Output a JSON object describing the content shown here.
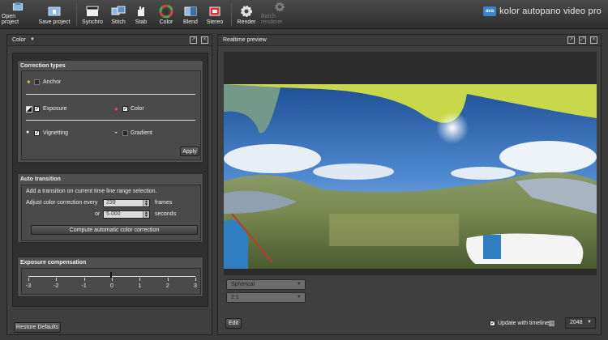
{
  "toolbar": {
    "items": [
      {
        "label": "Open project",
        "icon": "open-project-icon"
      },
      {
        "label": "Save project",
        "icon": "save-project-icon"
      },
      {
        "label": "Synchro",
        "icon": "clapperboard-icon"
      },
      {
        "label": "Stitch",
        "icon": "stitch-icon"
      },
      {
        "label": "Stab",
        "icon": "hand-icon"
      },
      {
        "label": "Color",
        "icon": "color-wheel-icon"
      },
      {
        "label": "Blend",
        "icon": "blend-icon"
      },
      {
        "label": "Stereo",
        "icon": "stereo-icon"
      },
      {
        "label": "Render",
        "icon": "gear-icon"
      },
      {
        "label": "Batch renderer",
        "icon": "batch-gear-icon"
      }
    ],
    "brand_logo": "ava",
    "brand_name": "kolor autopano video pro"
  },
  "color_panel": {
    "title": "Color",
    "dropdown_glyph": "▼",
    "correction_types": {
      "title": "Correction types",
      "anchor": "Anchor",
      "exposure": "Exposure",
      "color": "Color",
      "vignetting": "Vignetting",
      "gradient": "Gradient",
      "apply": "Apply"
    },
    "auto_transition": {
      "title": "Auto transition",
      "description": "Add a transition on current time line range selection.",
      "adjust_label": "Adjust color correction every",
      "frames_value": "239",
      "frames_unit": "frames",
      "or_label": "or",
      "seconds_value": "5.000",
      "seconds_unit": "seconds",
      "compute_button": "Compute automatic color correction"
    },
    "exposure_compensation": {
      "title": "Exposure compensation",
      "ticks": [
        "-3",
        "-2",
        "-1",
        "0",
        "1",
        "2",
        "3"
      ],
      "value": 0
    },
    "restore_defaults": "Restore Defaults"
  },
  "preview_panel": {
    "title": "Realtime preview",
    "projection": "Spherical",
    "ratio": "2:1",
    "edit_button": "Edit",
    "update_with_timeline": "Update with timeline",
    "resolution": "2048"
  },
  "colors": {
    "accent": "#3b86c9",
    "sky": "#3f7fc6",
    "parachute": "#c8d84a"
  }
}
